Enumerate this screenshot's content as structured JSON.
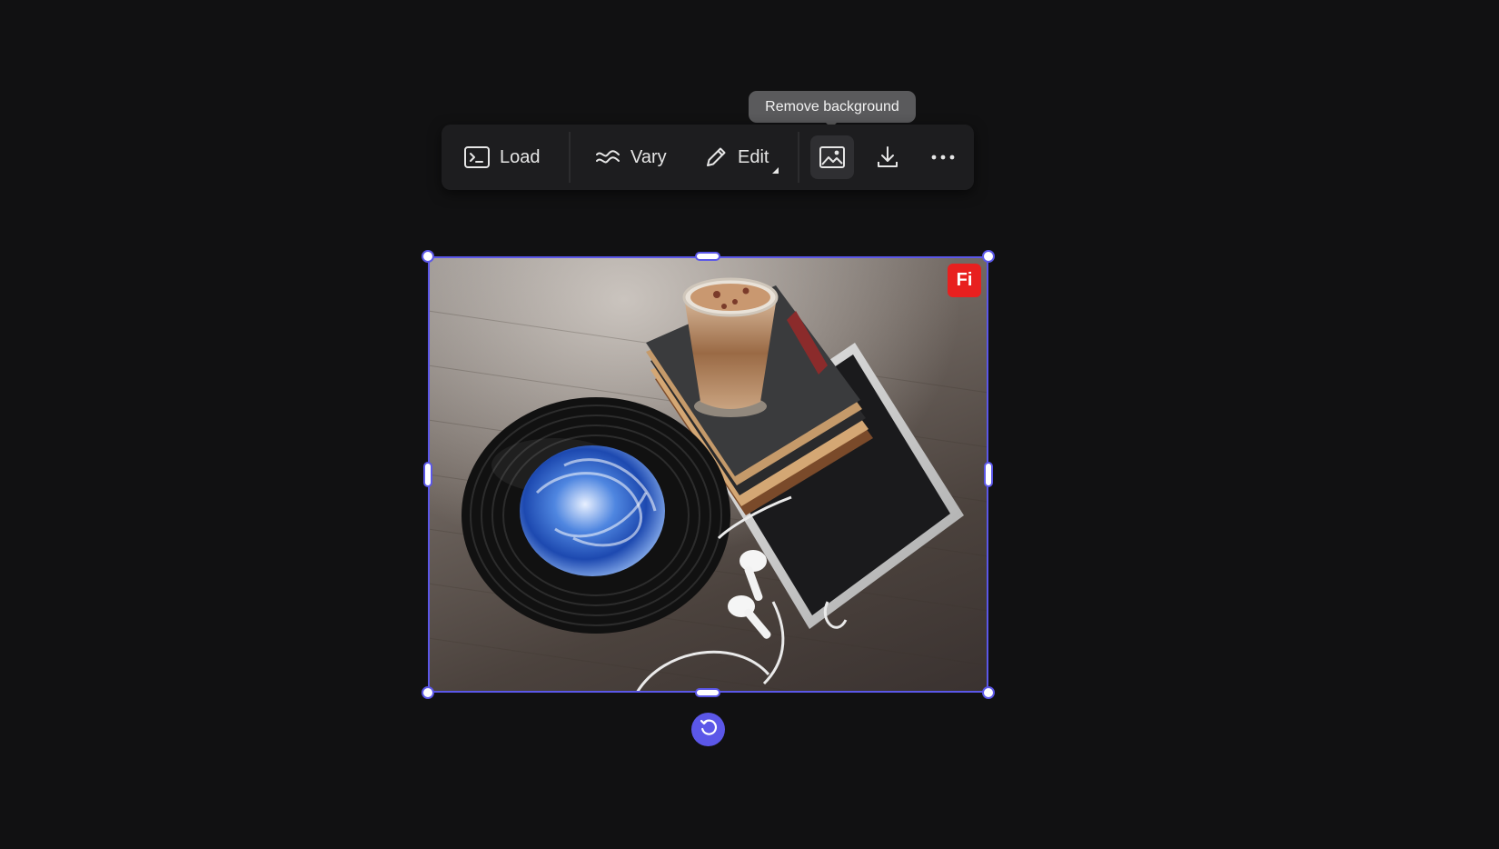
{
  "tooltip": {
    "text": "Remove background"
  },
  "toolbar": {
    "load_label": "Load",
    "vary_label": "Vary",
    "edit_label": "Edit",
    "icons": {
      "load": "terminal-icon",
      "vary": "approx-waves-icon",
      "edit": "pencil-icon",
      "remove_background": "image-icon",
      "download": "download-icon",
      "more": "more-horizontal-icon"
    }
  },
  "canvas": {
    "badge_text": "Fi",
    "selection_color": "#5b57e8",
    "badge_color": "#e8201f"
  }
}
